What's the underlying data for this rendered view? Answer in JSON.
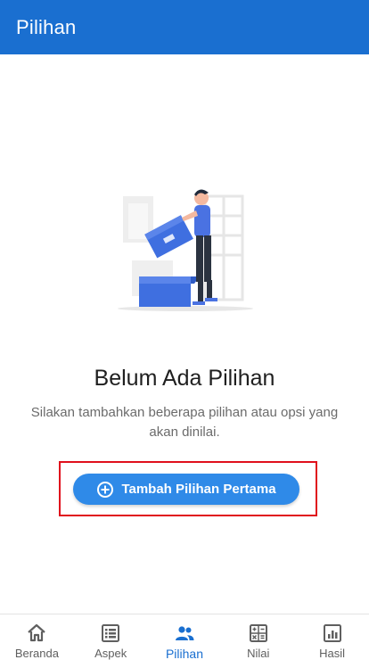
{
  "appbar": {
    "title": "Pilihan"
  },
  "empty_state": {
    "title": "Belum Ada Pilihan",
    "description": "Silakan tambahkan beberapa pilihan atau opsi yang akan dinilai.",
    "cta_label": "Tambah Pilihan Pertama",
    "cta_icon": "add-circle-icon",
    "illustration": "empty-boxes-illustration"
  },
  "colors": {
    "appbar": "#1a6fd0",
    "cta": "#2f8ae8",
    "highlight": "#e0101c",
    "active_nav": "#1a6fd0"
  },
  "bottom_nav": {
    "active": "Pilihan",
    "items": [
      {
        "label": "Beranda",
        "icon": "home-icon"
      },
      {
        "label": "Aspek",
        "icon": "list-icon"
      },
      {
        "label": "Pilihan",
        "icon": "people-icon"
      },
      {
        "label": "Nilai",
        "icon": "calculator-icon"
      },
      {
        "label": "Hasil",
        "icon": "chart-icon"
      }
    ]
  }
}
